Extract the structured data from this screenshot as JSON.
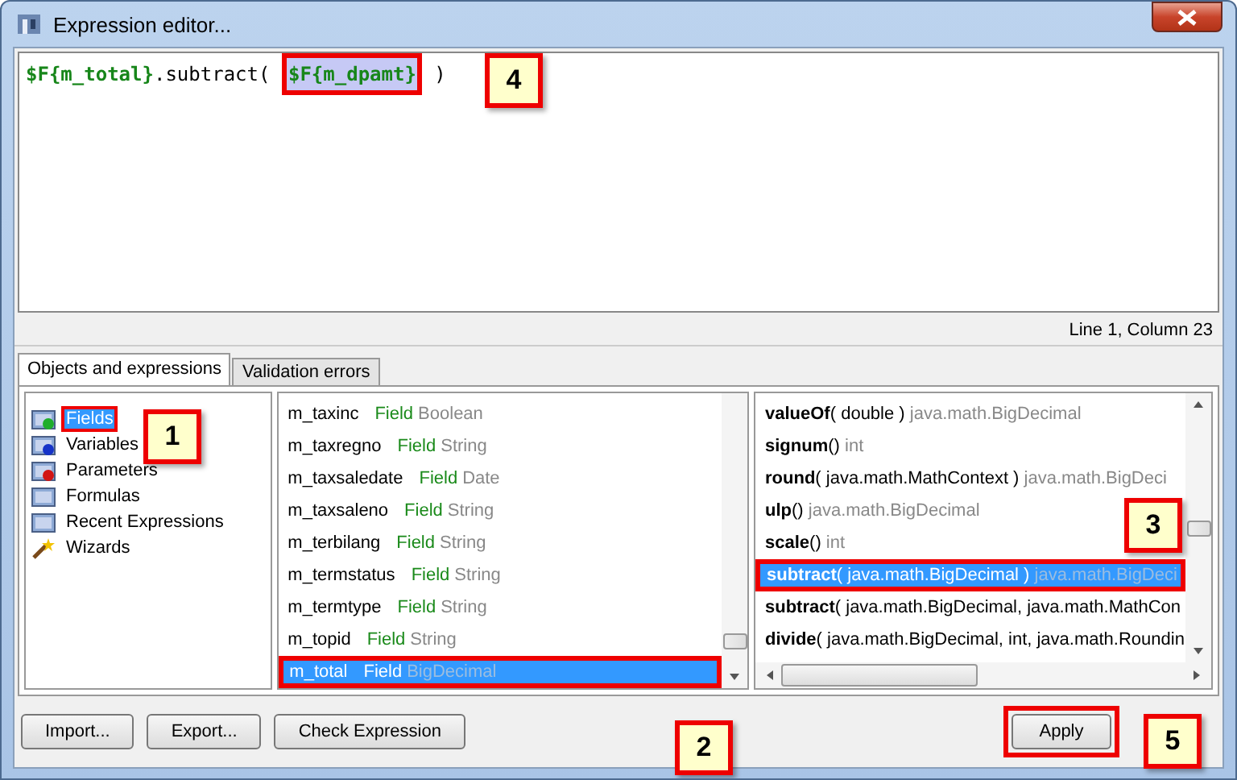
{
  "window": {
    "title": "Expression editor..."
  },
  "expression": [
    {
      "kind": "field",
      "text": "$F{m_total}",
      "selected": false
    },
    {
      "kind": "plain",
      "text": ".subtract( ",
      "selected": false
    },
    {
      "kind": "field",
      "text": "$F{m_dpamt}",
      "selected": true,
      "highlighted": true
    },
    {
      "kind": "plain",
      "text": " )",
      "selected": false
    }
  ],
  "status": "Line 1, Column 23",
  "tabs": [
    {
      "label": "Objects and expressions",
      "selected": true
    },
    {
      "label": "Validation errors",
      "selected": false
    }
  ],
  "tree": [
    {
      "label": "Fields",
      "selected": true,
      "highlighted": true
    },
    {
      "label": "Variables",
      "selected": false
    },
    {
      "label": "Parameters",
      "selected": false
    },
    {
      "label": "Formulas",
      "selected": false
    },
    {
      "label": "Recent Expressions",
      "selected": false
    },
    {
      "label": "Wizards",
      "selected": false
    }
  ],
  "fields": [
    {
      "name": "m_taxinc",
      "kind": "Field",
      "type": "Boolean",
      "selected": false
    },
    {
      "name": "m_taxregno",
      "kind": "Field",
      "type": "String",
      "selected": false
    },
    {
      "name": "m_taxsaledate",
      "kind": "Field",
      "type": "Date",
      "selected": false
    },
    {
      "name": "m_taxsaleno",
      "kind": "Field",
      "type": "String",
      "selected": false
    },
    {
      "name": "m_terbilang",
      "kind": "Field",
      "type": "String",
      "selected": false
    },
    {
      "name": "m_termstatus",
      "kind": "Field",
      "type": "String",
      "selected": false
    },
    {
      "name": "m_termtype",
      "kind": "Field",
      "type": "String",
      "selected": false
    },
    {
      "name": "m_topid",
      "kind": "Field",
      "type": "String",
      "selected": false
    },
    {
      "name": "m_total",
      "kind": "Field",
      "type": "BigDecimal",
      "selected": true,
      "highlighted": true
    }
  ],
  "methods": [
    {
      "name": "valueOf",
      "params": "( double )",
      "returns": "java.math.BigDecimal",
      "selected": false
    },
    {
      "name": "signum",
      "params": "()",
      "returns": "int",
      "selected": false
    },
    {
      "name": "round",
      "params": "( java.math.MathContext )",
      "returns": "java.math.BigDeci",
      "selected": false
    },
    {
      "name": "ulp",
      "params": "()",
      "returns": "java.math.BigDecimal",
      "selected": false
    },
    {
      "name": "scale",
      "params": "()",
      "returns": "int",
      "selected": false
    },
    {
      "name": "subtract",
      "params": "( java.math.BigDecimal )",
      "returns": "java.math.BigDeci",
      "selected": true,
      "highlighted": true
    },
    {
      "name": "subtract",
      "params": "( java.math.BigDecimal, java.math.MathCon",
      "selected": false
    },
    {
      "name": "divide",
      "params": "( java.math.BigDecimal, int, java.math.Roundin",
      "selected": false
    }
  ],
  "buttons": [
    "Import...",
    "Export...",
    "Check Expression"
  ],
  "apply_button": {
    "label": "Apply",
    "highlighted": true
  },
  "callouts": [
    "1",
    "2",
    "3",
    "4",
    "5"
  ]
}
